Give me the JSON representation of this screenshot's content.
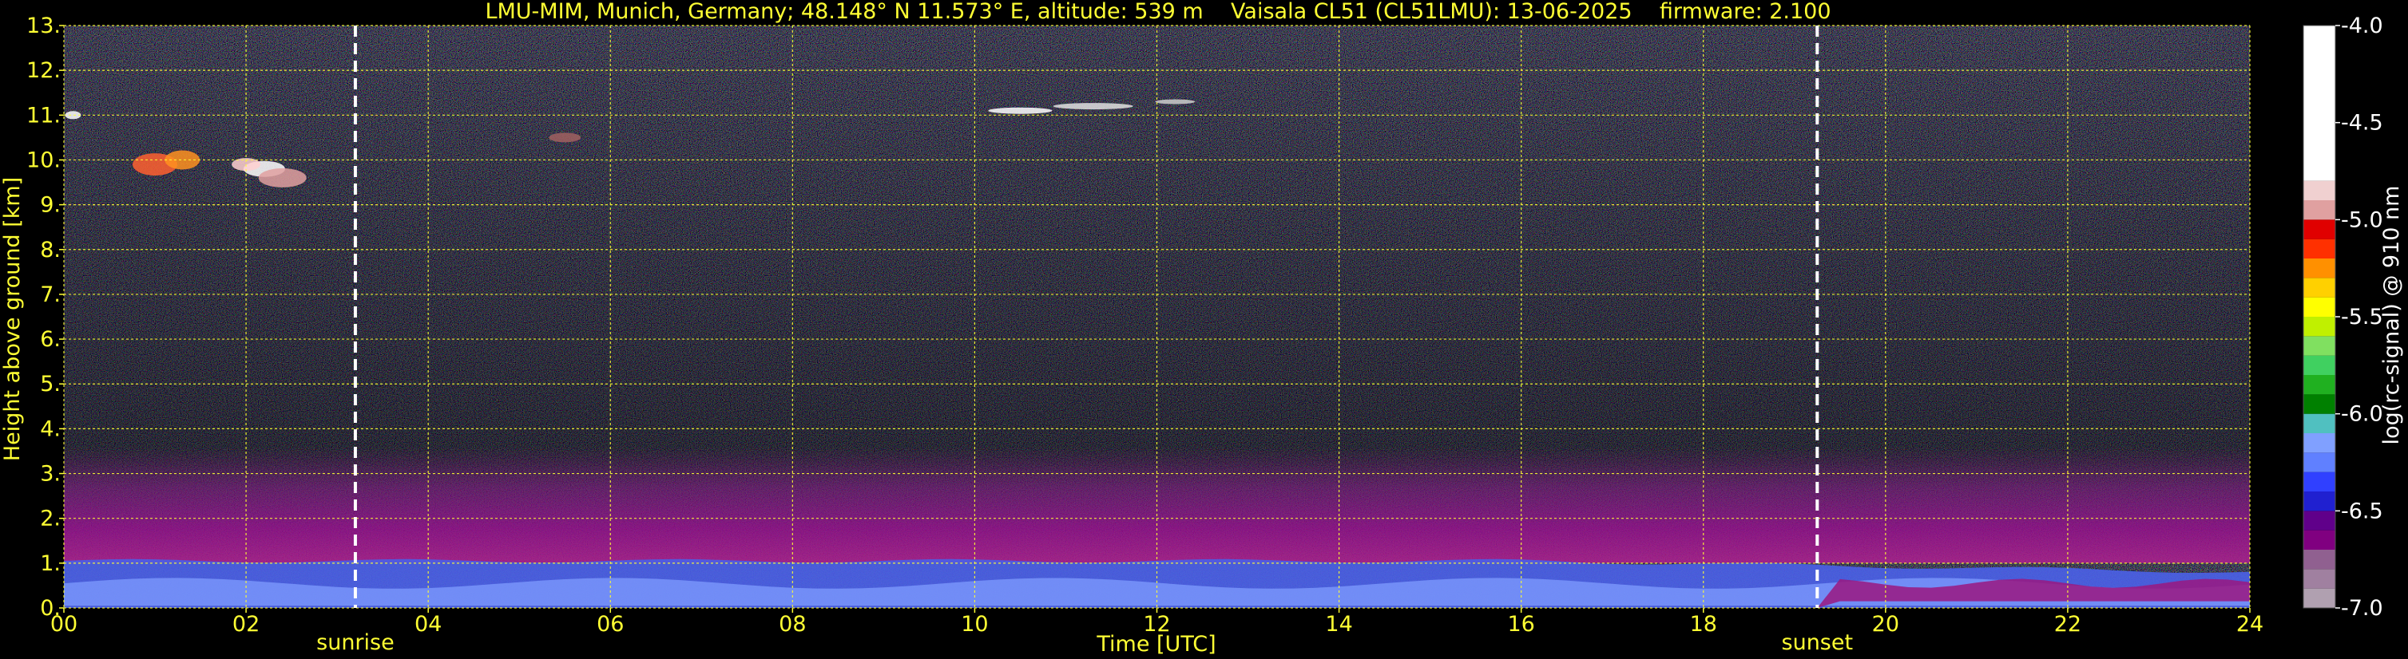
{
  "chart_data": {
    "type": "heatmap",
    "title": "LMU-MIM, Munich, Germany; 48.148° N 11.573° E, altitude: 539 m    Vaisala CL51 (CL51LMU): 13-06-2025    firmware: 2.100",
    "xlabel": "Time [UTC]",
    "ylabel": "Height above ground [km]",
    "xlim": [
      0,
      24
    ],
    "ylim": [
      0,
      13
    ],
    "x_ticks": [
      0,
      2,
      4,
      6,
      8,
      10,
      12,
      14,
      16,
      18,
      20,
      22,
      24
    ],
    "x_tick_labels": [
      "00",
      "02",
      "04",
      "06",
      "08",
      "10",
      "12",
      "14",
      "16",
      "18",
      "20",
      "22",
      "24"
    ],
    "y_ticks": [
      0,
      1,
      2,
      3,
      4,
      5,
      6,
      7,
      8,
      9,
      10,
      11,
      12,
      13
    ],
    "y_tick_labels": [
      "0.",
      "1.",
      "2.",
      "3.",
      "4.",
      "5.",
      "6.",
      "7.",
      "8.",
      "9.",
      "10.",
      "11.",
      "12.",
      "13."
    ],
    "grid": true,
    "events": [
      {
        "label": "sunrise",
        "time": 3.2
      },
      {
        "label": "sunset",
        "time": 19.25
      }
    ],
    "colorbar": {
      "label": "log(rc-signal) @ 910 nm",
      "range": [
        -7.0,
        -4.0
      ],
      "ticks": [
        -4.0,
        -4.5,
        -5.0,
        -5.5,
        -6.0,
        -6.5,
        -7.0
      ],
      "tick_labels": [
        "-4.0",
        "-4.5",
        "-5.0",
        "-5.5",
        "-6.0",
        "-6.5",
        "-7.0"
      ],
      "segments": [
        {
          "lo": -7.0,
          "hi": -6.9,
          "color": "#b0a0b0"
        },
        {
          "lo": -6.9,
          "hi": -6.8,
          "color": "#a080a0"
        },
        {
          "lo": -6.8,
          "hi": -6.7,
          "color": "#906090"
        },
        {
          "lo": -6.7,
          "hi": -6.6,
          "color": "#800080"
        },
        {
          "lo": -6.6,
          "hi": -6.5,
          "color": "#60008a"
        },
        {
          "lo": -6.5,
          "hi": -6.4,
          "color": "#2020d0"
        },
        {
          "lo": -6.4,
          "hi": -6.3,
          "color": "#3040ff"
        },
        {
          "lo": -6.3,
          "hi": -6.2,
          "color": "#6080ff"
        },
        {
          "lo": -6.2,
          "hi": -6.1,
          "color": "#80a0ff"
        },
        {
          "lo": -6.1,
          "hi": -6.0,
          "color": "#50c0c0"
        },
        {
          "lo": -6.0,
          "hi": -5.9,
          "color": "#008000"
        },
        {
          "lo": -5.9,
          "hi": -5.8,
          "color": "#20b020"
        },
        {
          "lo": -5.8,
          "hi": -5.7,
          "color": "#40d060"
        },
        {
          "lo": -5.7,
          "hi": -5.6,
          "color": "#80e060"
        },
        {
          "lo": -5.6,
          "hi": -5.5,
          "color": "#c0f000"
        },
        {
          "lo": -5.5,
          "hi": -5.4,
          "color": "#ffff00"
        },
        {
          "lo": -5.4,
          "hi": -5.3,
          "color": "#ffd000"
        },
        {
          "lo": -5.3,
          "hi": -5.2,
          "color": "#ff9000"
        },
        {
          "lo": -5.2,
          "hi": -5.1,
          "color": "#ff3000"
        },
        {
          "lo": -5.1,
          "hi": -5.0,
          "color": "#e00000"
        },
        {
          "lo": -5.0,
          "hi": -4.9,
          "color": "#e0a0a0"
        },
        {
          "lo": -4.9,
          "hi": -4.8,
          "color": "#f0d0d0"
        },
        {
          "lo": -4.8,
          "hi": -4.0,
          "color": "#ffffff"
        }
      ]
    },
    "colors": {
      "background": "#000000",
      "grid": "#ffff33",
      "text": "#ffff33",
      "event_line": "#ffffff"
    }
  }
}
